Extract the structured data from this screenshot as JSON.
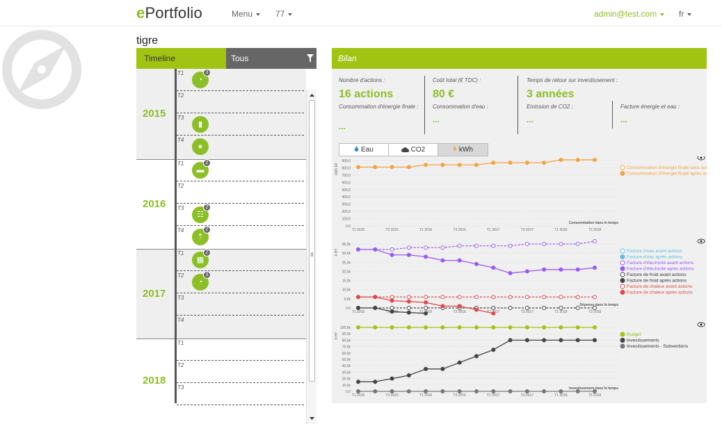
{
  "header": {
    "logo_e": "e",
    "logo_rest": "Portfolio",
    "menu_label": "Menu",
    "project_label": "77",
    "user_label": "admin@test.com",
    "lang_label": "fr"
  },
  "page_title": "tigre",
  "timeline": {
    "tab_label": "Timeline",
    "filter_label": "Tous",
    "years": [
      {
        "year": "2015",
        "quarters": [
          "T1",
          "T2",
          "T3",
          "T4"
        ]
      },
      {
        "year": "2016",
        "quarters": [
          "T1",
          "T2",
          "T3",
          "T4"
        ]
      },
      {
        "year": "2017",
        "quarters": [
          "T1",
          "T2",
          "T3",
          "T4"
        ]
      },
      {
        "year": "2018",
        "quarters": [
          "T1",
          "T2",
          "T3"
        ]
      }
    ],
    "actions": [
      {
        "year": "2015",
        "quarter": "T1",
        "icon": "gauge-icon",
        "badge": "3"
      },
      {
        "year": "2015",
        "quarter": "T3",
        "icon": "document-icon",
        "badge": ""
      },
      {
        "year": "2015",
        "quarter": "T4",
        "icon": "drop-icon",
        "badge": ""
      },
      {
        "year": "2016",
        "quarter": "T1",
        "icon": "truck-icon",
        "badge": "2"
      },
      {
        "year": "2016",
        "quarter": "T3",
        "icon": "network-icon",
        "badge": "2"
      },
      {
        "year": "2016",
        "quarter": "T4",
        "icon": "arrow-up-icon",
        "badge": "2"
      },
      {
        "year": "2017",
        "quarter": "T1",
        "icon": "building-icon",
        "badge": "2"
      },
      {
        "year": "2017",
        "quarter": "T2",
        "icon": "gauge-icon",
        "badge": "3"
      }
    ]
  },
  "bilan": {
    "title": "Bilan",
    "stats": {
      "nb_actions_label": "Nombre d'actions :",
      "nb_actions_value": "16 actions",
      "cout_label": "Coût total (€ TDC) :",
      "cout_value": "80 €",
      "retour_label": "Temps de retour sur investissement :",
      "retour_value": "3 années",
      "conso_energie_label": "Consommation d'énergie finale :",
      "conso_eau_label": "Consommation d'eau :",
      "co2_label": "Emission de CO2 :",
      "facture_label": "Facture énergie et eau :",
      "placeholder": "..."
    },
    "toggles": [
      "Eau",
      "CO2",
      "kWh"
    ],
    "active_toggle": "kWh"
  },
  "chart_data": [
    {
      "type": "line",
      "title": "Consommation dans le temps",
      "ylabel": "kWh EF",
      "x": [
        "T1 2015",
        "T2 2015",
        "T3 2015",
        "T4 2015",
        "T1 2016",
        "T2 2016",
        "T3 2016",
        "T4 2016",
        "T1 2017",
        "T2 2017",
        "T3 2017",
        "T4 2017",
        "T1 2018",
        "T2 2018",
        "T3 2018"
      ],
      "xticks": [
        "T1 2015",
        "T3 2015",
        "T1 2016",
        "T3 2016",
        "T1 2017",
        "T3 2017",
        "T1 2018",
        "T3 2018"
      ],
      "yticks": [
        "0,0",
        "100,0",
        "200,0",
        "300,0",
        "400,0",
        "500,0",
        "600,0",
        "700,0",
        "800,0",
        "900,0"
      ],
      "ylim": [
        0,
        900
      ],
      "series": [
        {
          "name": "Consommation d'énergie finale sans actions",
          "color": "#f5a245",
          "dashed": true,
          "hollow": true,
          "values": []
        },
        {
          "name": "Consommation d'énergie finale après actions",
          "color": "#f5a245",
          "dashed": false,
          "hollow": false,
          "values": [
            810,
            810,
            810,
            810,
            840,
            840,
            840,
            840,
            870,
            870,
            870,
            870,
            910,
            910,
            910
          ]
        }
      ],
      "legend_colors": [
        "#f5a245",
        "#f5a245"
      ]
    },
    {
      "type": "line",
      "title": "Dépense dans le temps",
      "ylabel": "€ HT",
      "x": [
        "T1 2015",
        "T2 2015",
        "T3 2015",
        "T4 2015",
        "T1 2016",
        "T2 2016",
        "T3 2016",
        "T4 2016",
        "T1 2017",
        "T2 2017",
        "T3 2017",
        "T4 2017",
        "T1 2018",
        "T2 2018",
        "T3 2018"
      ],
      "xticks": [
        "T1 2015",
        "T3 2015",
        "T1 2016",
        "T3 2016",
        "T1 2017",
        "T3 2017",
        "T1 2018",
        "T3 2018"
      ],
      "yticks": [
        "0,0",
        "5,0k",
        "10,0k",
        "15,0k",
        "20,0k",
        "25,0k",
        "30,0k",
        "35,0k"
      ],
      "ylim": [
        0,
        35000
      ],
      "series": [
        {
          "name": "Facture d'eau avant actions",
          "color": "#5bc0de",
          "dashed": true,
          "hollow": true,
          "values": []
        },
        {
          "name": "Facture d'eau après actions",
          "color": "#5bc0de",
          "dashed": false,
          "hollow": false,
          "values": []
        },
        {
          "name": "Facture d'électricité avant actions",
          "color": "#9b59f5",
          "dashed": true,
          "hollow": true,
          "values": [
            32000,
            32000,
            32000,
            33000,
            33000,
            33000,
            34000,
            34000,
            34000,
            34000,
            35000,
            35000,
            35000,
            35000,
            36500
          ]
        },
        {
          "name": "Facture d'électricité après actions",
          "color": "#9b59f5",
          "dashed": false,
          "hollow": false,
          "values": [
            32000,
            32000,
            29000,
            29000,
            28000,
            26000,
            26000,
            24000,
            22000,
            19000,
            20000,
            21000,
            21000,
            21000,
            22000
          ]
        },
        {
          "name": "Facture de froid avant actions",
          "color": "#444444",
          "dashed": true,
          "hollow": true,
          "values": [
            0,
            0,
            0,
            0,
            0,
            0,
            0,
            0,
            0,
            0,
            0,
            0,
            0,
            0,
            0
          ]
        },
        {
          "name": "Facture de froid après actions",
          "color": "#444444",
          "dashed": false,
          "hollow": false,
          "values": [
            0,
            0,
            -2000,
            -2500,
            -3000
          ]
        },
        {
          "name": "Facture de chaleur avant actions",
          "color": "#e04848",
          "dashed": true,
          "hollow": true,
          "values": [
            6000,
            6000,
            6000,
            6000,
            6000,
            6000,
            6000,
            6000,
            6000,
            6000,
            6000,
            6000,
            6000,
            6000,
            6000
          ]
        },
        {
          "name": "Facture de chaleur après actions",
          "color": "#e04848",
          "dashed": false,
          "hollow": false,
          "values": [
            6000,
            6000,
            4000,
            3500,
            3000,
            1000,
            1000,
            -1000,
            -3000
          ]
        }
      ]
    },
    {
      "type": "line",
      "title": "Investissement dans le temps",
      "ylabel": "€ HT",
      "x": [
        "T1 2015",
        "T2 2015",
        "T3 2015",
        "T4 2015",
        "T1 2016",
        "T2 2016",
        "T3 2016",
        "T4 2016",
        "T1 2017",
        "T2 2017",
        "T3 2017",
        "T4 2017",
        "T1 2018",
        "T2 2018",
        "T3 2018"
      ],
      "xticks": [
        "T1 2015",
        "T3 2015",
        "T1 2016",
        "T3 2016",
        "T1 2017",
        "T3 2017",
        "T1 2018",
        "T3 2018"
      ],
      "yticks": [
        "0,0",
        "10,0k",
        "20,0k",
        "30,0k",
        "40,0k",
        "50,0k",
        "60,0k",
        "70,0k",
        "80,0k",
        "90,0k",
        "100,0k"
      ],
      "ylim": [
        0,
        100000
      ],
      "series": [
        {
          "name": "Budget",
          "color": "#a1c412",
          "dashed": false,
          "hollow": false,
          "values": [
            100000,
            100000,
            100000,
            100000,
            100000,
            100000,
            100000,
            100000,
            100000,
            100000,
            100000,
            100000,
            100000,
            100000,
            100000
          ]
        },
        {
          "name": "Investissements",
          "color": "#444444",
          "dashed": false,
          "hollow": false,
          "values": [
            15000,
            15000,
            20000,
            25000,
            35000,
            35000,
            45000,
            55000,
            65000,
            80000,
            80000,
            80000,
            80000,
            80000,
            80000
          ]
        },
        {
          "name": "Investissements - Subventions",
          "color": "#777777",
          "dashed": false,
          "hollow": false,
          "values": [
            0,
            0,
            0,
            0,
            0,
            0,
            0,
            0,
            0,
            0,
            0,
            0,
            0,
            0,
            0
          ]
        }
      ]
    }
  ]
}
